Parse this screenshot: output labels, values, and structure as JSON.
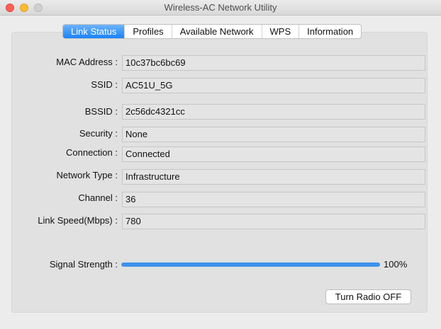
{
  "window": {
    "title": "Wireless-AC Network Utility"
  },
  "tabs": [
    {
      "label": "Link Status"
    },
    {
      "label": "Profiles"
    },
    {
      "label": "Available Network"
    },
    {
      "label": "WPS"
    },
    {
      "label": "Information"
    }
  ],
  "fields": [
    {
      "label": "MAC Address :",
      "value": "10c37bc6bc69"
    },
    {
      "label": "SSID :",
      "value": "AC51U_5G"
    },
    {
      "label": "BSSID :",
      "value": "2c56dc4321cc"
    },
    {
      "label": "Security :",
      "value": "None"
    },
    {
      "label": "Connection :",
      "value": "Connected"
    },
    {
      "label": "Network Type :",
      "value": "Infrastructure"
    },
    {
      "label": "Channel :",
      "value": "36"
    },
    {
      "label": "Link Speed(Mbps) :",
      "value": "780"
    }
  ],
  "signal": {
    "label": "Signal Strength :",
    "value_text": "100%",
    "percent": 100
  },
  "button": {
    "label": "Turn Radio OFF"
  }
}
